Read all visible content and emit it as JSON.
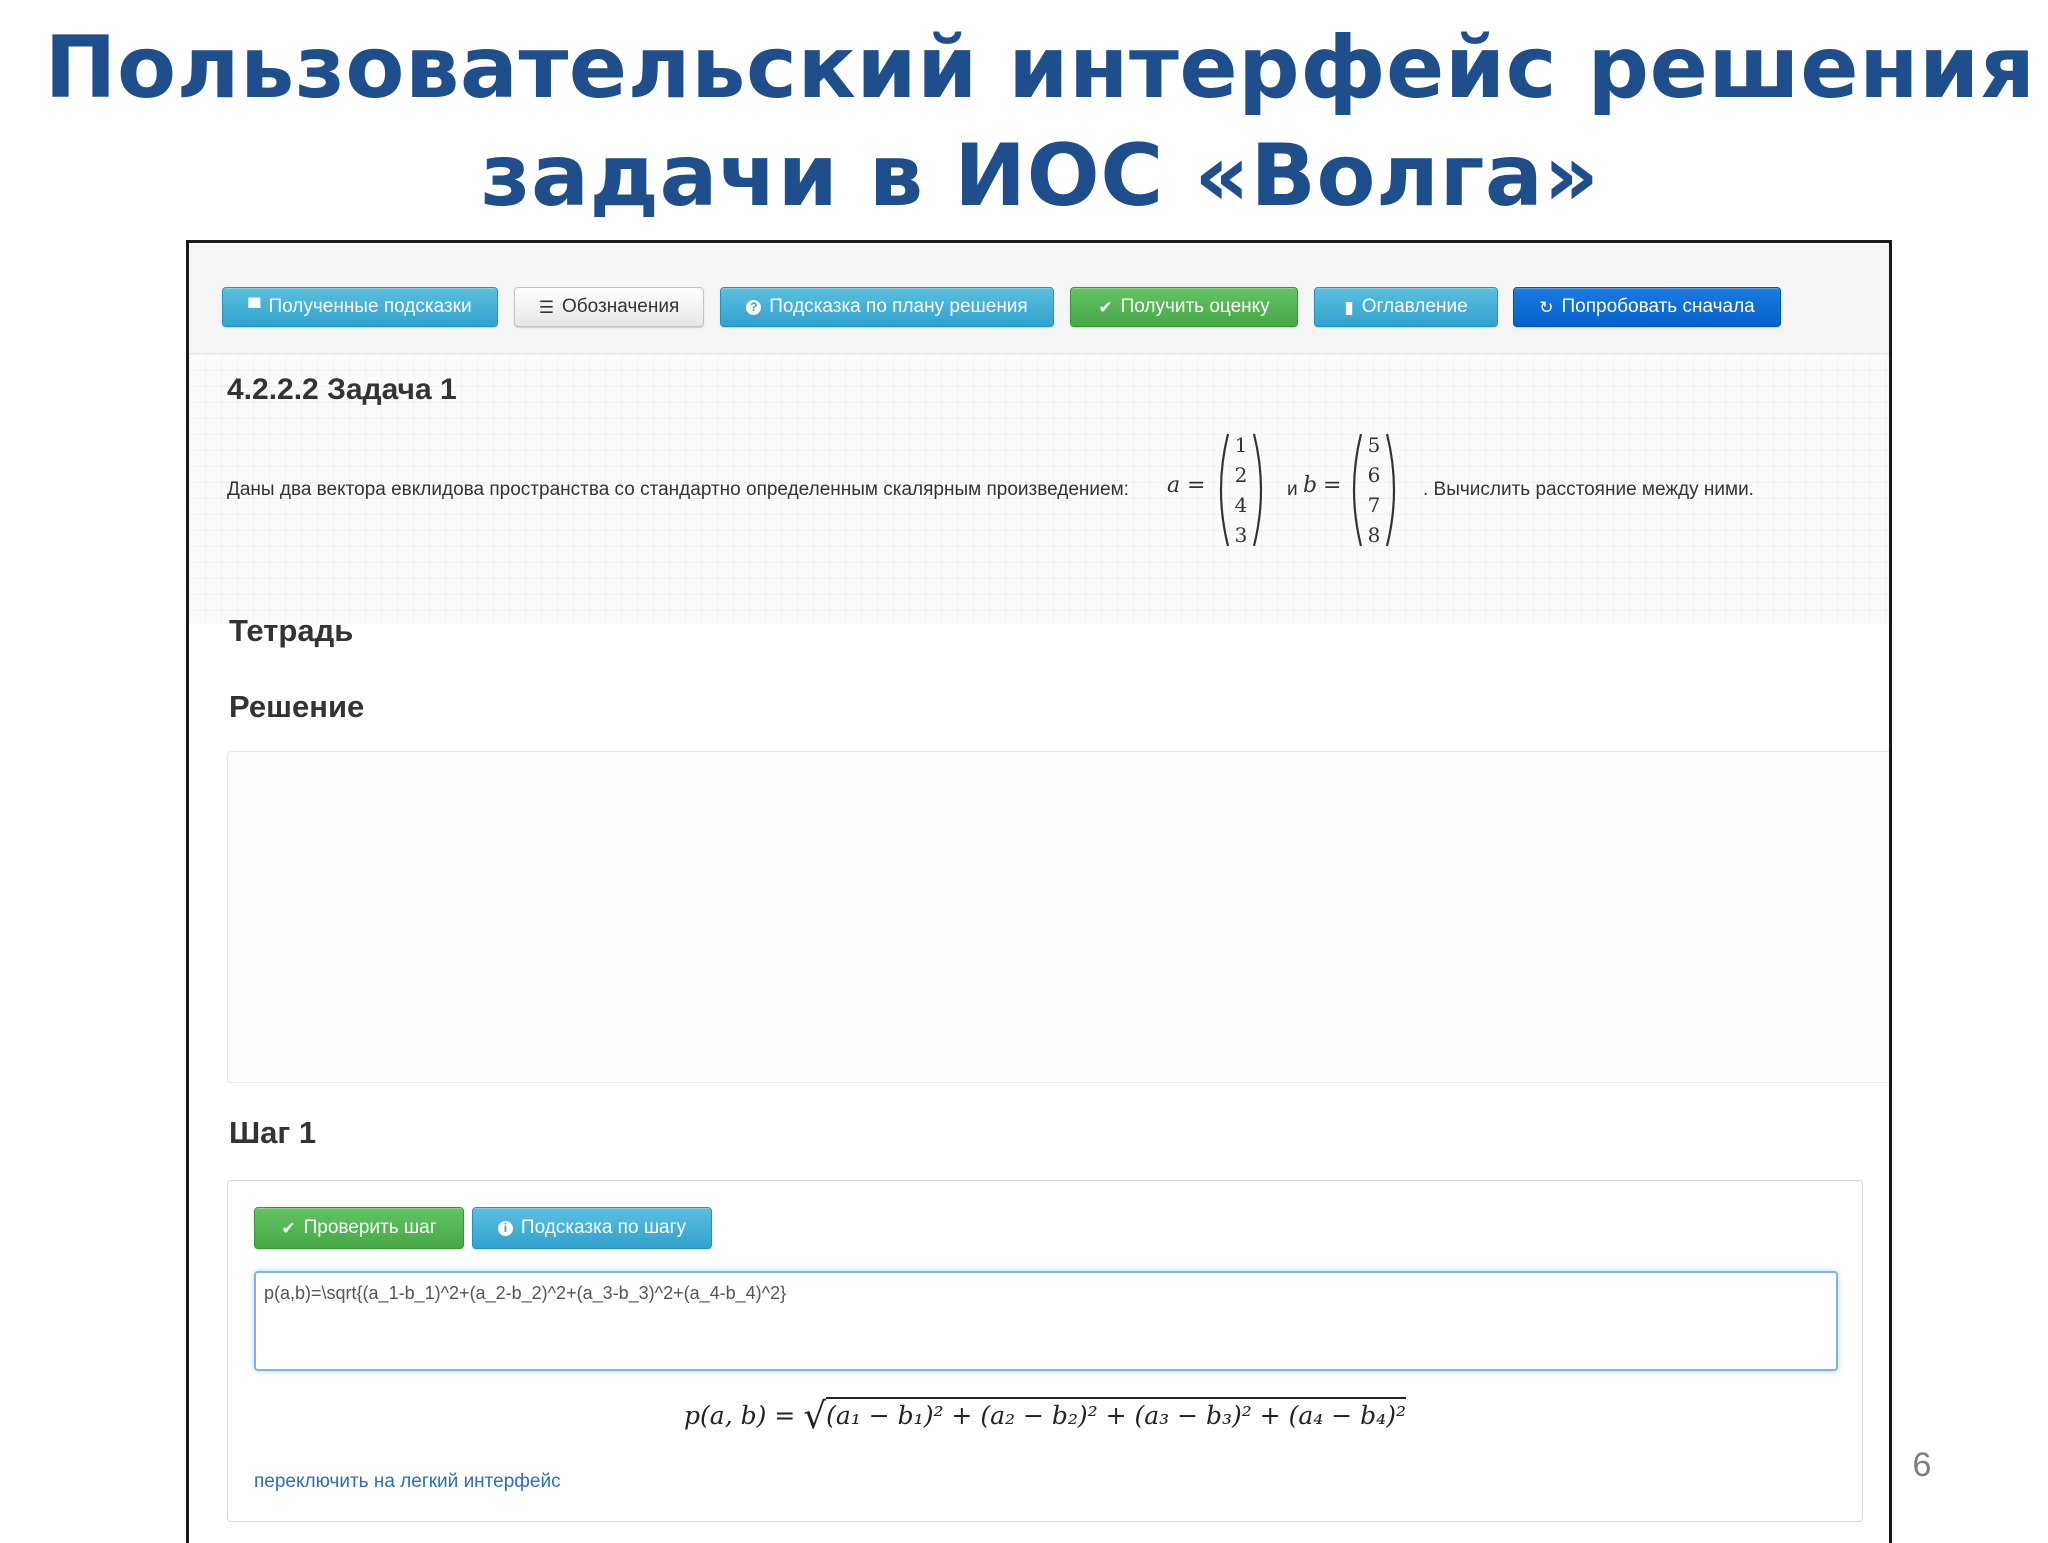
{
  "slide": {
    "title_line1": "Пользовательский интерфейс решения",
    "title_line2": "задачи в ИОС «Волга»",
    "page_number": "6"
  },
  "toolbar": {
    "buttons": [
      {
        "label": "Полученные подсказки",
        "icon": "comment-icon",
        "glyph": "▀",
        "style": "info"
      },
      {
        "label": "Обозначения",
        "icon": "list-icon",
        "glyph": "☰",
        "style": "default"
      },
      {
        "label": "Подсказка по плану решения",
        "icon": "question-circle-icon",
        "glyph": "?",
        "style": "info"
      },
      {
        "label": "Получить оценку",
        "icon": "check-icon",
        "glyph": "✔",
        "style": "success"
      },
      {
        "label": "Оглавление",
        "icon": "book-icon",
        "glyph": "▮",
        "style": "info"
      },
      {
        "label": "Попробовать сначала",
        "icon": "refresh-icon",
        "glyph": "↻",
        "style": "primary"
      }
    ]
  },
  "task": {
    "title": "4.2.2.2 Задача 1",
    "text_before": "Даны два вектора евклидова пространства со стандартно определенным скалярным произведением:",
    "var_a": "a",
    "eq1": "=",
    "conj": "и",
    "var_b": "b",
    "eq2": "=",
    "text_after": ". Вычислить расстояние между ними.",
    "vector_a": [
      "1",
      "2",
      "4",
      "3"
    ],
    "vector_b": [
      "5",
      "6",
      "7",
      "8"
    ]
  },
  "notebook": {
    "heading": "Тетрадь",
    "solution_heading": "Решение"
  },
  "step": {
    "heading": "Шаг 1",
    "check_button": "Проверить шаг",
    "hint_button": "Подсказка по шагу",
    "input_value": "p(a,b)=\\sqrt{(a_1-b_1)^2+(a_2-b_2)^2+(a_3-b_3)^2+(a_4-b_4)^2}",
    "rendered_lhs": "p(a, b) =",
    "rendered_root": "√",
    "rendered_radicand": "(a₁ − b₁)² + (a₂ − b₂)² + (a₃ − b₃)² + (a₄ − b₄)²",
    "switch_link": "переключить на легкий интерфейс"
  },
  "colors": {
    "title": "#1f4e8c",
    "info": "#31a1cf",
    "success": "#45a745",
    "primary": "#0561cc",
    "link": "#2a6fb5"
  }
}
